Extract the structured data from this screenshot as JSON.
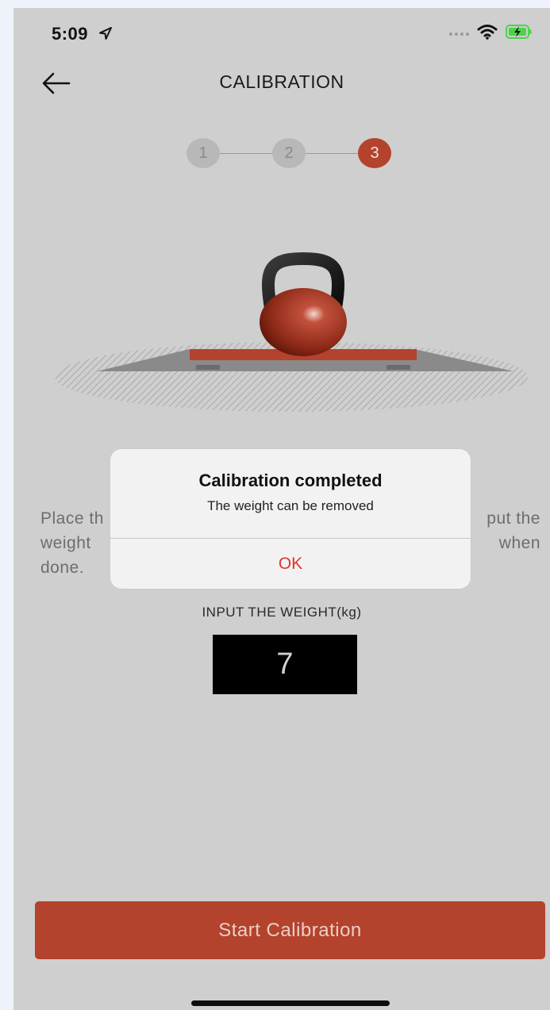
{
  "status_bar": {
    "time": "5:09",
    "icons": [
      "location-arrow-icon",
      "signal-icon",
      "wifi-icon",
      "battery-charging-icon"
    ]
  },
  "nav": {
    "title": "CALIBRATION",
    "back_icon": "arrow-left-icon"
  },
  "stepper": {
    "steps": [
      "1",
      "2",
      "3"
    ],
    "current": 3,
    "active_color": "#b3432d"
  },
  "illustration": {
    "icon": "kettlebell-on-scale-icon"
  },
  "instruction": {
    "line1_left": "Place th",
    "line1_right": "put the",
    "line2_left": "weight",
    "line2_right": "when",
    "line3_left": "done."
  },
  "weight_input": {
    "label": "INPUT THE WEIGHT(kg)",
    "value": "7"
  },
  "alert": {
    "title": "Calibration completed",
    "message": "The weight can be removed",
    "ok_label": "OK",
    "ok_color": "#e3342a"
  },
  "start_button": {
    "label": "Start Calibration",
    "color": "#b3432d"
  }
}
